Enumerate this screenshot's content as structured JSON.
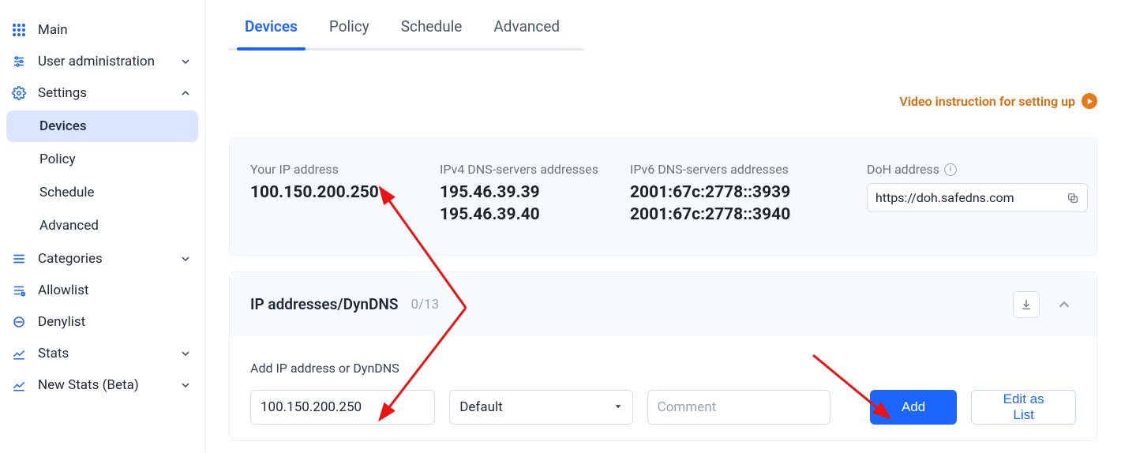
{
  "sidebar": {
    "items": [
      {
        "icon": "apps",
        "label": "Main",
        "expandable": false
      },
      {
        "icon": "sliders",
        "label": "User administration",
        "expandable": true,
        "open": false
      },
      {
        "icon": "gear",
        "label": "Settings",
        "expandable": true,
        "open": true,
        "sub": [
          {
            "label": "Devices",
            "active": true
          },
          {
            "label": "Policy",
            "active": false
          },
          {
            "label": "Schedule",
            "active": false
          },
          {
            "label": "Advanced",
            "active": false
          }
        ]
      },
      {
        "icon": "list",
        "label": "Categories",
        "expandable": true,
        "open": false
      },
      {
        "icon": "allow",
        "label": "Allowlist",
        "expandable": false
      },
      {
        "icon": "deny",
        "label": "Denylist",
        "expandable": false
      },
      {
        "icon": "chart",
        "label": "Stats",
        "expandable": true,
        "open": false
      },
      {
        "icon": "chart",
        "label": "New Stats (Beta)",
        "expandable": true,
        "open": false
      }
    ]
  },
  "tabs": [
    {
      "label": "Devices",
      "active": true
    },
    {
      "label": "Policy",
      "active": false
    },
    {
      "label": "Schedule",
      "active": false
    },
    {
      "label": "Advanced",
      "active": false
    }
  ],
  "video_instruction": "Video instruction for setting up",
  "info": {
    "your_ip_label": "Your IP address",
    "your_ip": "100.150.200.250",
    "ipv4_label": "IPv4 DNS-servers addresses",
    "ipv4": [
      "195.46.39.39",
      "195.46.39.40"
    ],
    "ipv6_label": "IPv6 DNS-servers addresses",
    "ipv6": [
      "2001:67c:2778::3939",
      "2001:67c:2778::3940"
    ],
    "doh_label": "DoH address",
    "doh_value": "https://doh.safedns.com"
  },
  "dyndns": {
    "title": "IP addresses/DynDNS",
    "count": "0/13",
    "add_label": "Add IP address or DynDNS",
    "ip_input": "100.150.200.250",
    "policy_selected": "Default",
    "comment_placeholder": "Comment",
    "add_btn": "Add",
    "edit_btn": "Edit as List"
  }
}
